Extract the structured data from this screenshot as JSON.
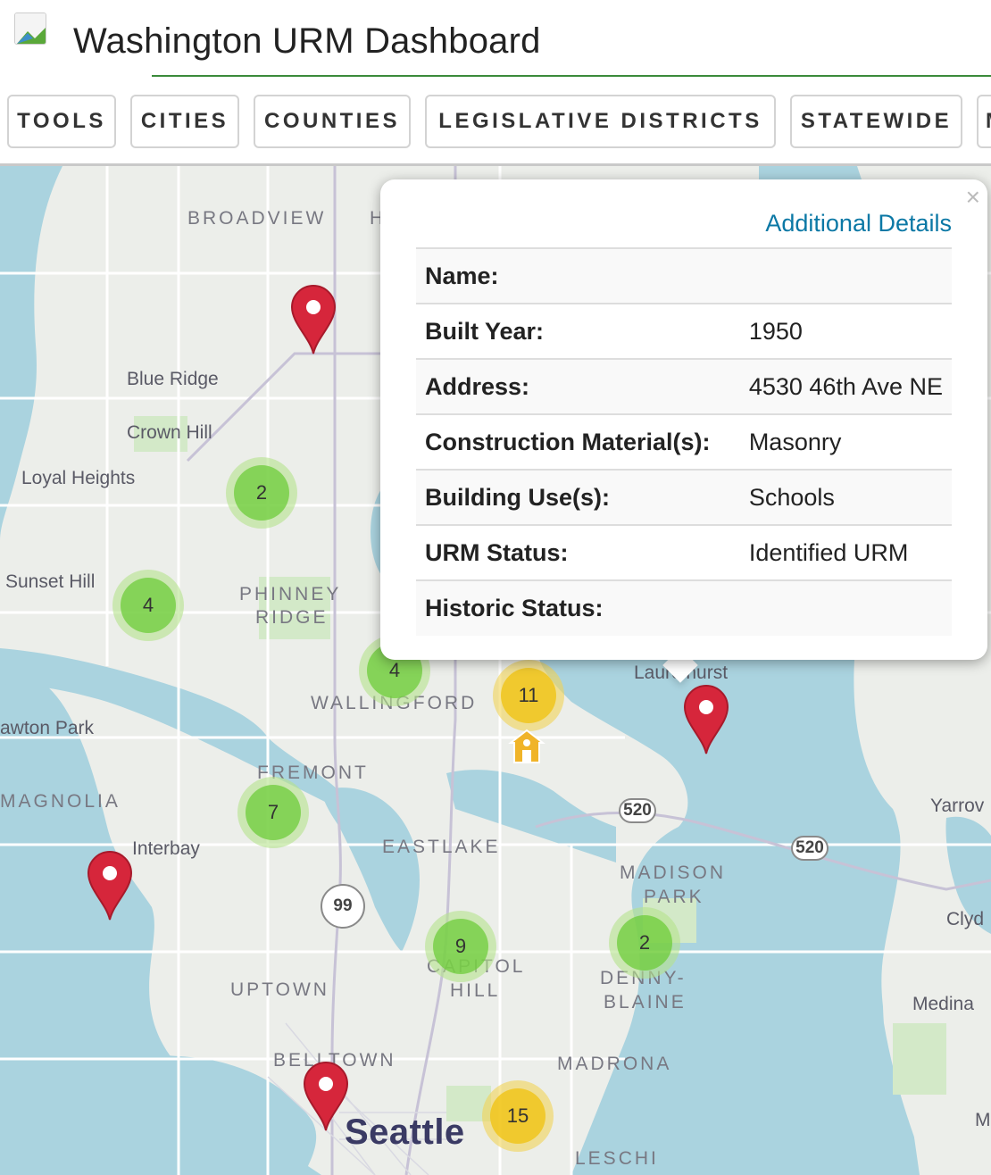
{
  "header": {
    "title": "Washington URM Dashboard",
    "logo_icon": "broken-image-icon"
  },
  "nav": {
    "buttons": [
      "TOOLS",
      "CITIES",
      "COUNTIES",
      "LEGISLATIVE DISTRICTS",
      "STATEWIDE",
      "M"
    ]
  },
  "map": {
    "places": {
      "broadview": "BROADVIEW",
      "h": "H",
      "blue_ridge": "Blue Ridge",
      "crown_hill": "Crown Hill",
      "loyal_heights": "Loyal Heights",
      "sunset_hill": "Sunset Hill",
      "phinney": "PHINNEY",
      "ridge": "RIDGE",
      "wallingford": "WALLINGFORD",
      "laurelhurst": "Laurelhurst",
      "lawton_park": "awton Park",
      "magnolia": "MAGNOLIA",
      "fremont": "FREMONT",
      "interbay": "Interbay",
      "eastlake": "EASTLAKE",
      "madison": "MADISON",
      "park": "PARK",
      "yarrow": "Yarrov",
      "clyde": "Clyd",
      "medina": "Medina",
      "capitol": "CAPITOL",
      "hill": "HILL",
      "denny": "DENNY-",
      "blaine": "BLAINE",
      "uptown": "UPTOWN",
      "belltown": "BELLTOWN",
      "madrona": "MADRONA",
      "seattle": "Seattle",
      "leschi": "LESCHI",
      "m_edge": "M"
    },
    "clusters": [
      "2",
      "4",
      "4",
      "11",
      "7",
      "9",
      "2",
      "15"
    ],
    "shields": [
      "520",
      "520",
      "99"
    ],
    "colors": {
      "water": "#aad3df",
      "land": "#eceeea",
      "park": "#d3e9c8",
      "marker": "#d6263b",
      "cluster_green": "#6ecc39",
      "cluster_yellow": "#f0c20c",
      "link": "#0b78a5"
    }
  },
  "popup": {
    "link": "Additional Details",
    "close": "×",
    "rows": [
      {
        "label": "Name:",
        "value": ""
      },
      {
        "label": "Built Year:",
        "value": "1950"
      },
      {
        "label": "Address:",
        "value": "4530 46th Ave NE"
      },
      {
        "label": "Construction Material(s):",
        "value": "Masonry"
      },
      {
        "label": "Building Use(s):",
        "value": "Schools"
      },
      {
        "label": "URM Status:",
        "value": "Identified URM"
      },
      {
        "label": "Historic Status:",
        "value": ""
      }
    ]
  }
}
